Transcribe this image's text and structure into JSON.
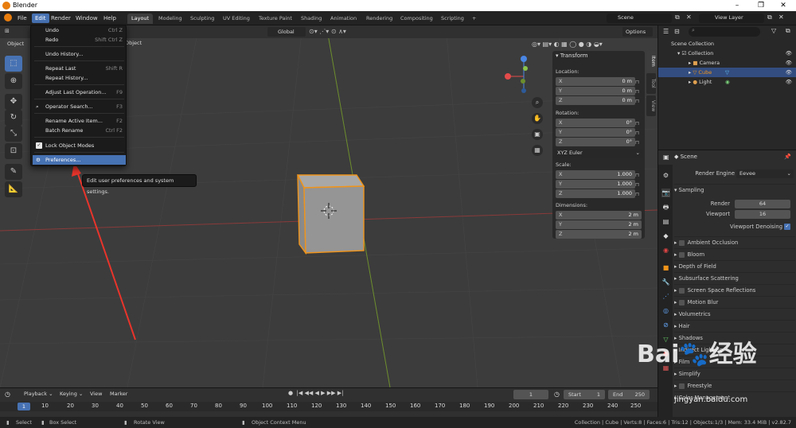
{
  "window": {
    "title": "Blender",
    "min": "–",
    "max": "❐",
    "close": "✕"
  },
  "menubar": [
    "File",
    "Edit",
    "Render",
    "Window",
    "Help"
  ],
  "workspaces": [
    "Layout",
    "Modeling",
    "Sculpting",
    "UV Editing",
    "Texture Paint",
    "Shading",
    "Animation",
    "Rendering",
    "Compositing",
    "Scripting",
    "+"
  ],
  "scene_name": "Scene",
  "view_layer": "View Layer",
  "viewport": {
    "header_left": "Object",
    "header_obj": "Object",
    "orientation": "Global",
    "options": "Options"
  },
  "edit_menu": {
    "items": [
      {
        "label": "Undo",
        "shortcut": "Ctrl Z"
      },
      {
        "label": "Redo",
        "shortcut": "Shift Ctrl Z"
      },
      {
        "label": "Undo History...",
        "shortcut": ""
      },
      {
        "label": "Repeat Last",
        "shortcut": "Shift R"
      },
      {
        "label": "Repeat History...",
        "shortcut": ""
      },
      {
        "label": "Adjust Last Operation...",
        "shortcut": "F9"
      },
      {
        "label": "Operator Search...",
        "shortcut": "F3"
      },
      {
        "label": "Rename Active Item...",
        "shortcut": "F2"
      },
      {
        "label": "Batch Rename",
        "shortcut": "Ctrl F2"
      },
      {
        "label": "Lock Object Modes",
        "shortcut": ""
      },
      {
        "label": "Preferences...",
        "shortcut": ""
      }
    ],
    "tooltip": "Edit user preferences and system settings."
  },
  "transform": {
    "title": "Transform",
    "location_label": "Location:",
    "location": [
      {
        "axis": "X",
        "value": "0 m"
      },
      {
        "axis": "Y",
        "value": "0 m"
      },
      {
        "axis": "Z",
        "value": "0 m"
      }
    ],
    "rotation_label": "Rotation:",
    "rotation": [
      {
        "axis": "X",
        "value": "0°"
      },
      {
        "axis": "Y",
        "value": "0°"
      },
      {
        "axis": "Z",
        "value": "0°"
      }
    ],
    "rotation_mode": "XYZ Euler",
    "scale_label": "Scale:",
    "scale": [
      {
        "axis": "X",
        "value": "1.000"
      },
      {
        "axis": "Y",
        "value": "1.000"
      },
      {
        "axis": "Z",
        "value": "1.000"
      }
    ],
    "dimensions_label": "Dimensions:",
    "dimensions": [
      {
        "axis": "X",
        "value": "2 m"
      },
      {
        "axis": "Y",
        "value": "2 m"
      },
      {
        "axis": "Z",
        "value": "2 m"
      }
    ]
  },
  "side_tabs": [
    "Item",
    "Tool",
    "View"
  ],
  "outliner": {
    "rows": [
      "Scene Collection",
      "Collection",
      "Camera",
      "Cube",
      "Light"
    ]
  },
  "properties": {
    "scene": "Scene",
    "render_engine_label": "Render Engine",
    "render_engine": "Eevee",
    "sampling": "Sampling",
    "render_label": "Render",
    "render_value": "64",
    "viewport_label": "Viewport",
    "viewport_value": "16",
    "denoise": "Viewport Denoising",
    "sections": [
      "Ambient Occlusion",
      "Bloom",
      "Depth of Field",
      "Subsurface Scattering",
      "Screen Space Reflections",
      "Motion Blur",
      "Volumetrics",
      "Hair",
      "Shadows",
      "Indirect Lighting",
      "Film",
      "Simplify",
      "Freestyle",
      "Color Management"
    ]
  },
  "timeline": {
    "menus": [
      "Playback",
      "Keying",
      "View",
      "Marker"
    ],
    "frame": "1",
    "start_label": "Start",
    "start": "1",
    "end_label": "End",
    "end": "250",
    "ticks": [
      "1",
      "10",
      "20",
      "30",
      "40",
      "50",
      "60",
      "70",
      "80",
      "90",
      "100",
      "110",
      "120",
      "130",
      "140",
      "150",
      "160",
      "170",
      "180",
      "190",
      "200",
      "210",
      "220",
      "230",
      "240",
      "250"
    ]
  },
  "statusbar": {
    "select": "Select",
    "box_select": "Box Select",
    "rotate_view": "Rotate View",
    "context_menu": "Object Context Menu",
    "stats": "Collection | Cube | Verts:8 | Faces:6 | Tris:12 | Objects:1/3 | Mem: 33.4 MiB | v2.82.7"
  },
  "watermark": {
    "brand": "Bai",
    "brand2": "经验",
    "url": "jingyan.baidu.com"
  }
}
